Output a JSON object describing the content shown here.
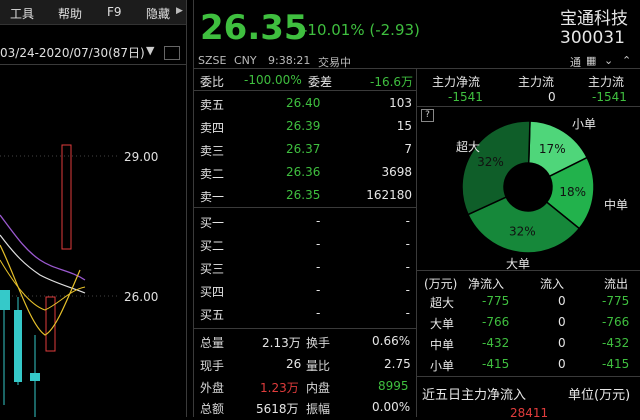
{
  "menu": {
    "tools": "工具",
    "help": "帮助",
    "f9": "F9",
    "hide": "隐藏"
  },
  "chart": {
    "range": "03/24-2020/07/30(87日)",
    "price_high": "29.00",
    "price_low": "26.00"
  },
  "quote": {
    "price": "26.35",
    "change": "-10.01% (-2.93)",
    "name": "宝通科技",
    "code": "300031",
    "tong_label": "通"
  },
  "status": {
    "exchange": "SZSE",
    "currency": "CNY",
    "time": "9:38:21",
    "state": "交易中"
  },
  "weibi": {
    "label": "委比",
    "value": "-100.00%",
    "diff_label": "委差",
    "diff_value": "-16.6万"
  },
  "sell": [
    {
      "label": "卖五",
      "price": "26.40",
      "vol": "103"
    },
    {
      "label": "卖四",
      "price": "26.39",
      "vol": "15"
    },
    {
      "label": "卖三",
      "price": "26.37",
      "vol": "7"
    },
    {
      "label": "卖二",
      "price": "26.36",
      "vol": "3698"
    },
    {
      "label": "卖一",
      "price": "26.35",
      "vol": "162180"
    }
  ],
  "buy": [
    {
      "label": "买一",
      "price": "-",
      "vol": "-"
    },
    {
      "label": "买二",
      "price": "-",
      "vol": "-"
    },
    {
      "label": "买三",
      "price": "-",
      "vol": "-"
    },
    {
      "label": "买四",
      "price": "-",
      "vol": "-"
    },
    {
      "label": "买五",
      "price": "-",
      "vol": "-"
    }
  ],
  "stats": {
    "zongliang_l": "总量",
    "zongliang_v": "2.13万",
    "huanshou_l": "换手",
    "huanshou_v": "0.66%",
    "xianshou_l": "现手",
    "xianshou_v": "26",
    "liangbi_l": "量比",
    "liangbi_v": "2.75",
    "waipan_l": "外盘",
    "waipan_v": "1.23万",
    "neipan_l": "内盘",
    "neipan_v": "8995",
    "zonge_l": "总额",
    "zonge_v": "5618万",
    "zhenfu_l": "振幅",
    "zhenfu_v": "0.00%"
  },
  "flow": {
    "h1": "主力净流",
    "h2": "主力流",
    "h3": "主力流",
    "v1": "-1541",
    "v2": "0",
    "v3": "-1541",
    "help": "?"
  },
  "pie": {
    "labels": {
      "xiaodan": "小单",
      "zhongdan": "中单",
      "dadan": "大单",
      "chaoda": "超大"
    },
    "slices": [
      {
        "name": "小单",
        "pct": 17,
        "text": "17%",
        "color": "#4fd67a"
      },
      {
        "name": "中单",
        "pct": 18,
        "text": "18%",
        "color": "#22b24c"
      },
      {
        "name": "大单",
        "pct": 32,
        "text": "32%",
        "color": "#16883a"
      },
      {
        "name": "超大",
        "pct": 32,
        "text": "32%",
        "color": "#0f5e29"
      }
    ]
  },
  "flowtable": {
    "headers": [
      "(万元)",
      "净流入",
      "流入",
      "流出"
    ],
    "rows": [
      {
        "label": "超大",
        "net": "-775",
        "in": "0",
        "out": "-775"
      },
      {
        "label": "大单",
        "net": "-766",
        "in": "0",
        "out": "-766"
      },
      {
        "label": "中单",
        "net": "-432",
        "in": "0",
        "out": "-432"
      },
      {
        "label": "小单",
        "net": "-415",
        "in": "0",
        "out": "-415"
      }
    ]
  },
  "five_day": {
    "title": "近五日主力净流入",
    "unit": "单位(万元)",
    "value": "28411"
  }
}
